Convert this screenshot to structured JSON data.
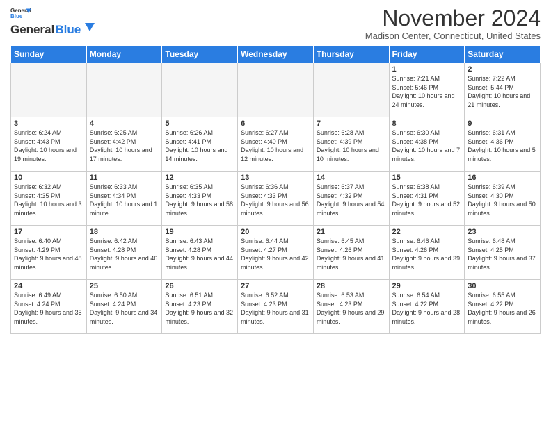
{
  "header": {
    "logo_general": "General",
    "logo_blue": "Blue",
    "month": "November 2024",
    "location": "Madison Center, Connecticut, United States"
  },
  "days_of_week": [
    "Sunday",
    "Monday",
    "Tuesday",
    "Wednesday",
    "Thursday",
    "Friday",
    "Saturday"
  ],
  "weeks": [
    [
      {
        "day": "",
        "info": ""
      },
      {
        "day": "",
        "info": ""
      },
      {
        "day": "",
        "info": ""
      },
      {
        "day": "",
        "info": ""
      },
      {
        "day": "",
        "info": ""
      },
      {
        "day": "1",
        "info": "Sunrise: 7:21 AM\nSunset: 5:46 PM\nDaylight: 10 hours and 24 minutes."
      },
      {
        "day": "2",
        "info": "Sunrise: 7:22 AM\nSunset: 5:44 PM\nDaylight: 10 hours and 21 minutes."
      }
    ],
    [
      {
        "day": "3",
        "info": "Sunrise: 6:24 AM\nSunset: 4:43 PM\nDaylight: 10 hours and 19 minutes."
      },
      {
        "day": "4",
        "info": "Sunrise: 6:25 AM\nSunset: 4:42 PM\nDaylight: 10 hours and 17 minutes."
      },
      {
        "day": "5",
        "info": "Sunrise: 6:26 AM\nSunset: 4:41 PM\nDaylight: 10 hours and 14 minutes."
      },
      {
        "day": "6",
        "info": "Sunrise: 6:27 AM\nSunset: 4:40 PM\nDaylight: 10 hours and 12 minutes."
      },
      {
        "day": "7",
        "info": "Sunrise: 6:28 AM\nSunset: 4:39 PM\nDaylight: 10 hours and 10 minutes."
      },
      {
        "day": "8",
        "info": "Sunrise: 6:30 AM\nSunset: 4:38 PM\nDaylight: 10 hours and 7 minutes."
      },
      {
        "day": "9",
        "info": "Sunrise: 6:31 AM\nSunset: 4:36 PM\nDaylight: 10 hours and 5 minutes."
      }
    ],
    [
      {
        "day": "10",
        "info": "Sunrise: 6:32 AM\nSunset: 4:35 PM\nDaylight: 10 hours and 3 minutes."
      },
      {
        "day": "11",
        "info": "Sunrise: 6:33 AM\nSunset: 4:34 PM\nDaylight: 10 hours and 1 minute."
      },
      {
        "day": "12",
        "info": "Sunrise: 6:35 AM\nSunset: 4:33 PM\nDaylight: 9 hours and 58 minutes."
      },
      {
        "day": "13",
        "info": "Sunrise: 6:36 AM\nSunset: 4:33 PM\nDaylight: 9 hours and 56 minutes."
      },
      {
        "day": "14",
        "info": "Sunrise: 6:37 AM\nSunset: 4:32 PM\nDaylight: 9 hours and 54 minutes."
      },
      {
        "day": "15",
        "info": "Sunrise: 6:38 AM\nSunset: 4:31 PM\nDaylight: 9 hours and 52 minutes."
      },
      {
        "day": "16",
        "info": "Sunrise: 6:39 AM\nSunset: 4:30 PM\nDaylight: 9 hours and 50 minutes."
      }
    ],
    [
      {
        "day": "17",
        "info": "Sunrise: 6:40 AM\nSunset: 4:29 PM\nDaylight: 9 hours and 48 minutes."
      },
      {
        "day": "18",
        "info": "Sunrise: 6:42 AM\nSunset: 4:28 PM\nDaylight: 9 hours and 46 minutes."
      },
      {
        "day": "19",
        "info": "Sunrise: 6:43 AM\nSunset: 4:28 PM\nDaylight: 9 hours and 44 minutes."
      },
      {
        "day": "20",
        "info": "Sunrise: 6:44 AM\nSunset: 4:27 PM\nDaylight: 9 hours and 42 minutes."
      },
      {
        "day": "21",
        "info": "Sunrise: 6:45 AM\nSunset: 4:26 PM\nDaylight: 9 hours and 41 minutes."
      },
      {
        "day": "22",
        "info": "Sunrise: 6:46 AM\nSunset: 4:26 PM\nDaylight: 9 hours and 39 minutes."
      },
      {
        "day": "23",
        "info": "Sunrise: 6:48 AM\nSunset: 4:25 PM\nDaylight: 9 hours and 37 minutes."
      }
    ],
    [
      {
        "day": "24",
        "info": "Sunrise: 6:49 AM\nSunset: 4:24 PM\nDaylight: 9 hours and 35 minutes."
      },
      {
        "day": "25",
        "info": "Sunrise: 6:50 AM\nSunset: 4:24 PM\nDaylight: 9 hours and 34 minutes."
      },
      {
        "day": "26",
        "info": "Sunrise: 6:51 AM\nSunset: 4:23 PM\nDaylight: 9 hours and 32 minutes."
      },
      {
        "day": "27",
        "info": "Sunrise: 6:52 AM\nSunset: 4:23 PM\nDaylight: 9 hours and 31 minutes."
      },
      {
        "day": "28",
        "info": "Sunrise: 6:53 AM\nSunset: 4:23 PM\nDaylight: 9 hours and 29 minutes."
      },
      {
        "day": "29",
        "info": "Sunrise: 6:54 AM\nSunset: 4:22 PM\nDaylight: 9 hours and 28 minutes."
      },
      {
        "day": "30",
        "info": "Sunrise: 6:55 AM\nSunset: 4:22 PM\nDaylight: 9 hours and 26 minutes."
      }
    ]
  ]
}
